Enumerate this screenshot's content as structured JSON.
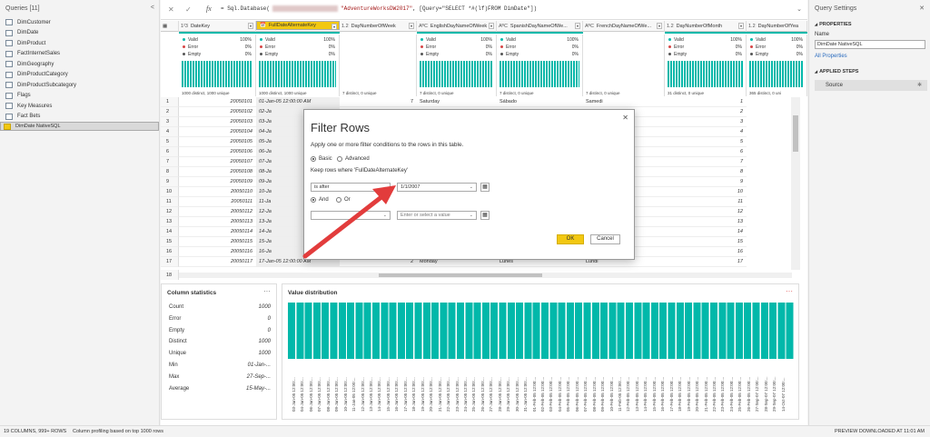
{
  "queries_pane": {
    "title": "Queries [11]",
    "collapse_glyph": "<",
    "items": [
      "DimCustomer",
      "DimDate",
      "DimProduct",
      "FactInternetSales",
      "DimGeography",
      "DimProductCategory",
      "DimProductSubcategory",
      "Flags",
      "Key Measures",
      "Fact Bets",
      "DimDate NativeSQL"
    ],
    "selected_index": 10
  },
  "formula_bar": {
    "cancel": "✕",
    "commit": "✓",
    "fx": "fx",
    "formula_prefix": "= Sql.Database(",
    "formula_db": "\"AdventureWorksDW2017\"",
    "formula_query": ", [Query=\"SELECT *#(lf)FROM DimDate\"])",
    "expand": "⌄"
  },
  "columns": [
    {
      "type": "1²3",
      "name": "DateKey"
    },
    {
      "type": "📅",
      "name": "FullDateAlternateKey",
      "selected": true
    },
    {
      "type": "1.2",
      "name": "DayNumberOfWeek"
    },
    {
      "type": "AᴮC",
      "name": "EnglishDayNameOfWeek"
    },
    {
      "type": "AᴮC",
      "name": "SpanishDayNameOfWe..."
    },
    {
      "type": "AᴮC",
      "name": "FrenchDayNameOfWe..."
    },
    {
      "type": "1.2",
      "name": "DayNumberOfMonth"
    },
    {
      "type": "1.2",
      "name": "DayNumberOfYea"
    }
  ],
  "profile": {
    "valid_label": "Valid",
    "error_label": "Error",
    "empty_label": "Empty",
    "valid_pct": "100%",
    "error_pct": "0%",
    "empty_pct": "0%",
    "distinct": [
      "1000 distinct, 1000 unique",
      "1000 distinct, 1000 unique",
      "7 distinct, 0 unique",
      "7 distinct, 0 unique",
      "7 distinct, 0 unique",
      "7 distinct, 0 unique",
      "31 distinct, 0 unique",
      "365 distinct, 0 uni"
    ],
    "valid_fraction": 1.0
  },
  "rows": [
    {
      "n": "1",
      "key": "20050101",
      "date": "01-Jan-05 12:00:00 AM",
      "dow": "7",
      "en": "Saturday",
      "es": "Sábado",
      "fr": "Samedi",
      "dom": "1"
    },
    {
      "n": "2",
      "key": "20050102",
      "date": "02-Ja",
      "dom": "2"
    },
    {
      "n": "3",
      "key": "20050103",
      "date": "03-Ja",
      "dom": "3"
    },
    {
      "n": "4",
      "key": "20050104",
      "date": "04-Ja",
      "dom": "4"
    },
    {
      "n": "5",
      "key": "20050105",
      "date": "05-Ja",
      "dom": "5"
    },
    {
      "n": "6",
      "key": "20050106",
      "date": "06-Ja",
      "dom": "6"
    },
    {
      "n": "7",
      "key": "20050107",
      "date": "07-Ja",
      "dom": "7"
    },
    {
      "n": "8",
      "key": "20050108",
      "date": "08-Ja",
      "dom": "8"
    },
    {
      "n": "9",
      "key": "20050109",
      "date": "09-Ja",
      "dom": "9"
    },
    {
      "n": "10",
      "key": "20050110",
      "date": "10-Ja",
      "dom": "10"
    },
    {
      "n": "11",
      "key": "20050111",
      "date": "11-Ja",
      "dom": "11"
    },
    {
      "n": "12",
      "key": "20050112",
      "date": "12-Ja",
      "dom": "12"
    },
    {
      "n": "13",
      "key": "20050113",
      "date": "13-Ja",
      "dom": "13"
    },
    {
      "n": "14",
      "key": "20050114",
      "date": "14-Ja",
      "dom": "14"
    },
    {
      "n": "15",
      "key": "20050115",
      "date": "15-Ja",
      "dom": "15"
    },
    {
      "n": "16",
      "key": "20050116",
      "date": "16-Ja",
      "dom": "16"
    },
    {
      "n": "17",
      "key": "20050117",
      "date": "17-Jan-05 12:00:00 AM",
      "dow": "2",
      "en": "Monday",
      "es": "Lunes",
      "fr": "Lundi",
      "dom": "17"
    }
  ],
  "row18_label": "18",
  "column_statistics": {
    "title": "Column statistics",
    "more": "···",
    "items": [
      {
        "k": "Count",
        "v": "1000"
      },
      {
        "k": "Error",
        "v": "0"
      },
      {
        "k": "Empty",
        "v": "0"
      },
      {
        "k": "Distinct",
        "v": "1000"
      },
      {
        "k": "Unique",
        "v": "1000"
      },
      {
        "k": "Min",
        "v": "01-Jan-..."
      },
      {
        "k": "Max",
        "v": "27-Sep-..."
      },
      {
        "k": "Average",
        "v": "15-May-..."
      }
    ]
  },
  "value_distribution": {
    "title": "Value distribution",
    "more": "···",
    "labels": [
      "03-Jan-05 12:00:...",
      "04-Jan-05 12:00:...",
      "06-Jan-05 12:00:...",
      "07-Jan-05 12:00:...",
      "08-Jan-05 12:00:...",
      "09-Jan-05 12:00:...",
      "10-Jan-05 12:00:...",
      "11-Jan-05 12:00:...",
      "12-Jan-05 12:00:...",
      "13-Jan-05 12:00:...",
      "14-Jan-05 12:00:...",
      "15-Jan-05 12:00:...",
      "16-Jan-05 12:00:...",
      "17-Jan-05 12:00:...",
      "18-Jan-05 12:00:...",
      "19-Jan-05 12:00:...",
      "20-Jan-05 12:00:...",
      "21-Jan-05 12:00:...",
      "22-Jan-05 12:00:...",
      "23-Jan-05 12:00:...",
      "24-Jan-05 12:00:...",
      "25-Jan-05 12:00:...",
      "26-Jan-05 12:00:...",
      "27-Jan-05 12:00:...",
      "28-Jan-05 12:00:...",
      "29-Jan-05 12:00:...",
      "30-Jan-05 12:00:...",
      "31-Jan-05 12:00:...",
      "01-Feb-05 12:00:...",
      "02-Feb-05 12:00:...",
      "03-Feb-05 12:00:...",
      "04-Feb-05 12:00:...",
      "05-Feb-05 12:00:...",
      "06-Feb-05 12:00:...",
      "07-Feb-05 12:00:...",
      "08-Feb-05 12:00:...",
      "09-Feb-05 12:00:...",
      "10-Feb-05 12:00:...",
      "11-Feb-05 12:00:...",
      "12-Feb-05 12:00:...",
      "13-Feb-05 12:00:...",
      "14-Feb-05 12:00:...",
      "15-Feb-05 12:00:...",
      "16-Feb-05 12:00:...",
      "17-Feb-05 12:00:...",
      "18-Feb-05 12:00:...",
      "19-Feb-05 12:00:...",
      "20-Feb-05 12:00:...",
      "21-Feb-05 12:00:...",
      "22-Feb-05 12:00:...",
      "23-Feb-05 12:00:...",
      "24-Feb-05 12:00:...",
      "25-Feb-05 12:00:...",
      "26-Feb-05 12:00:...",
      "27-Sep-07 12:00:...",
      "28-Sep-07 12:00:...",
      "29-Sep-07 12:00:...",
      "14-Oct-07 12:00:..."
    ]
  },
  "settings_pane": {
    "title": "Query Settings",
    "close": "✕",
    "properties": "PROPERTIES",
    "name_label": "Name",
    "name_value": "DimDate NativeSQL",
    "all_properties": "All Properties",
    "applied_steps": "APPLIED STEPS",
    "step": "Source"
  },
  "dialog": {
    "title": "Filter Rows",
    "close": "✕",
    "description": "Apply one or more filter conditions to the rows in this table.",
    "basic": "Basic",
    "advanced": "Advanced",
    "keep_rows": "Keep rows where 'FullDateAlternateKey'",
    "op1": "is after",
    "val1": "1/1/2007",
    "and": "And",
    "or": "Or",
    "op2": "",
    "val2_placeholder": "Enter or select a value",
    "ok": "OK",
    "cancel": "Cancel"
  },
  "status_bar": {
    "left": "19 COLUMNS, 999+ ROWS",
    "profiling": "Column profiling based on top 1000 rows",
    "right": "PREVIEW DOWNLOADED AT 11:01 AM"
  },
  "colors": {
    "teal": "#01b8aa",
    "accent": "#f2c811",
    "arrow": "#e23c3c"
  }
}
